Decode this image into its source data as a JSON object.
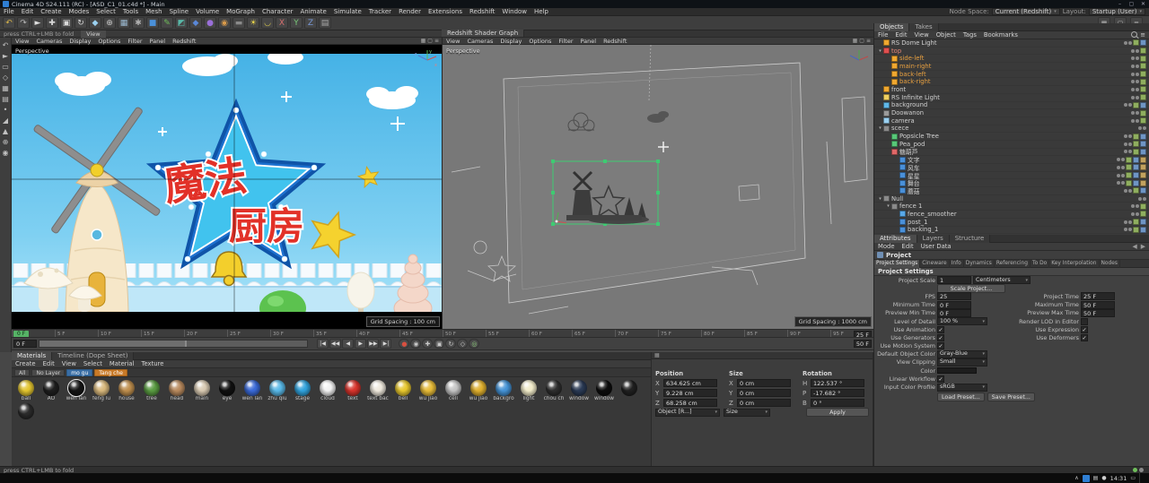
{
  "titlebar": {
    "title": "Cinema 4D S24.111 (RC) - [ASD_C1_01.c4d *] - Main",
    "minimize": "–",
    "maximize": "▢",
    "close": "✕"
  },
  "menubar": {
    "items": [
      "File",
      "Edit",
      "Create",
      "Modes",
      "Select",
      "Tools",
      "Mesh",
      "Spline",
      "Volume",
      "MoGraph",
      "Character",
      "Animate",
      "Simulate",
      "Tracker",
      "Render",
      "Extensions",
      "Redshift",
      "Window",
      "Help"
    ],
    "node_space_label": "Node Space:",
    "node_space_value": "Current (Redshift)",
    "layout_label": "Layout:",
    "layout_value": "Startup (User)"
  },
  "toolbar": {
    "icons": [
      {
        "name": "undo-icon",
        "glyph": "↶",
        "color": "#d8b44a"
      },
      {
        "name": "redo-icon",
        "glyph": "↷",
        "color": "#b8b8b8"
      },
      {
        "name": "live-selection-icon",
        "glyph": "►",
        "color": "#e0e0e0"
      },
      {
        "name": "move-icon",
        "glyph": "✚",
        "color": "#d8d8d8"
      },
      {
        "name": "scale-icon",
        "glyph": "▣",
        "color": "#d8d8d8"
      },
      {
        "name": "rotate-icon",
        "glyph": "↻",
        "color": "#d8d8d8"
      },
      {
        "name": "last-tool-icon",
        "glyph": "◆",
        "color": "#9ad0f0"
      },
      {
        "name": "coordinate-system-icon",
        "glyph": "⊕",
        "color": "#c8c8c8"
      },
      {
        "name": "render-view-icon",
        "glyph": "▦",
        "color": "#9ab8d0"
      },
      {
        "name": "render-settings-icon",
        "glyph": "✱",
        "color": "#b0b0b0"
      },
      {
        "name": "primitive-cube-icon",
        "glyph": "■",
        "color": "#4a90d9"
      },
      {
        "name": "spline-pen-icon",
        "glyph": "✎",
        "color": "#6fbf5a"
      },
      {
        "name": "subdivision-surface-icon",
        "glyph": "◩",
        "color": "#58b8a8"
      },
      {
        "name": "mograph-icon",
        "glyph": "◆",
        "color": "#5a88d8"
      },
      {
        "name": "volume-icon",
        "glyph": "●",
        "color": "#9a6fd9"
      },
      {
        "name": "simulate-icon",
        "glyph": "◉",
        "color": "#d89a4a"
      },
      {
        "name": "camera-tool-icon",
        "glyph": "▬",
        "color": "#8a8a8a"
      },
      {
        "name": "light-tool-icon",
        "glyph": "☀",
        "color": "#e8d44a"
      },
      {
        "name": "snap-icon",
        "glyph": "◡",
        "color": "#d8c84a"
      },
      {
        "name": "axis-x-lock-icon",
        "glyph": "X",
        "color": "#d87070"
      },
      {
        "name": "axis-y-lock-icon",
        "glyph": "Y",
        "color": "#78c878"
      },
      {
        "name": "axis-z-lock-icon",
        "glyph": "Z",
        "color": "#7898d8"
      },
      {
        "name": "workplane-icon",
        "glyph": "▤",
        "color": "#a8a8a8"
      }
    ]
  },
  "fold_strip": {
    "hint": "press CTRL+LMB to fold",
    "tab": "View"
  },
  "tool_column": {
    "icons": [
      {
        "name": "undo-icon",
        "glyph": "↶"
      },
      {
        "name": "selection-icon",
        "glyph": "►"
      },
      {
        "name": "rect-select-icon",
        "glyph": "▭"
      },
      {
        "name": "model-mode-icon",
        "glyph": "◇"
      },
      {
        "name": "texture-mode-icon",
        "glyph": "▦"
      },
      {
        "name": "workplane-mode-icon",
        "glyph": "▤"
      },
      {
        "name": "points-mode-icon",
        "glyph": "•"
      },
      {
        "name": "edges-mode-icon",
        "glyph": "◢"
      },
      {
        "name": "polygons-mode-icon",
        "glyph": "▲"
      },
      {
        "name": "enable-axis-icon",
        "glyph": "⊕"
      },
      {
        "name": "snap-mode-icon",
        "glyph": "◉"
      }
    ]
  },
  "left_viewport": {
    "menu": [
      "View",
      "Cameras",
      "Display",
      "Options",
      "Filter",
      "Panel",
      "Redshift"
    ],
    "label": "Perspective",
    "grid_spacing": "Grid Spacing : 100 cm",
    "title_part1": "魔法",
    "title_part2": "厨房"
  },
  "right_viewport": {
    "tab": "Redshift Shader Graph",
    "menu": [
      "View",
      "Cameras",
      "Display",
      "Options",
      "Filter",
      "Panel",
      "Redshift"
    ],
    "label": "Perspective",
    "grid_spacing": "Grid Spacing : 1000 cm"
  },
  "timeline": {
    "tick_start": 0,
    "tick_end": 95,
    "tick_step": 5,
    "tick_suffix": " F",
    "playhead": "0 F",
    "current_frame": "0 F",
    "preview_end": "25 F",
    "range_end": "50 F",
    "transport": [
      {
        "name": "goto-start-button",
        "glyph": "|◀"
      },
      {
        "name": "prev-key-button",
        "glyph": "◀◀"
      },
      {
        "name": "prev-frame-button",
        "glyph": "◀"
      },
      {
        "name": "play-button",
        "glyph": "▶"
      },
      {
        "name": "next-frame-button",
        "glyph": "▶▶"
      },
      {
        "name": "goto-end-button",
        "glyph": "▶|"
      }
    ],
    "record": [
      {
        "name": "record-button",
        "glyph": "●",
        "color": "#d85040"
      },
      {
        "name": "autokey-button",
        "glyph": "◉",
        "color": "#c8c8c8"
      },
      {
        "name": "keyframe-position-button",
        "glyph": "✚",
        "color": "#c8c8c8"
      },
      {
        "name": "keyframe-scale-button",
        "glyph": "▣",
        "color": "#c8c8c8"
      },
      {
        "name": "keyframe-rotation-button",
        "glyph": "↻",
        "color": "#c8c8c8"
      },
      {
        "name": "keyframe-params-button",
        "glyph": "◇",
        "color": "#c8c8c8"
      },
      {
        "name": "solo-button",
        "glyph": "◎",
        "color": "#8ac879"
      }
    ]
  },
  "objects_panel": {
    "tabs": [
      "Objects",
      "Takes"
    ],
    "active_tab": "Objects",
    "menu": [
      "File",
      "Edit",
      "View",
      "Object",
      "Tags",
      "Bookmarks"
    ],
    "items": [
      {
        "name": "RS Dome Light",
        "depth": 0,
        "icon": "#f0a830",
        "tags": 2
      },
      {
        "name": "top",
        "depth": 0,
        "arrow": true,
        "icon": "#e05050",
        "color": "#e88878",
        "tags": 1
      },
      {
        "name": "side-left",
        "depth": 1,
        "icon": "#f0a830",
        "color": "#e8a040",
        "tags": 1
      },
      {
        "name": "main-right",
        "depth": 1,
        "icon": "#f0a830",
        "color": "#e8a040",
        "tags": 1
      },
      {
        "name": "back-left",
        "depth": 1,
        "icon": "#f0a830",
        "color": "#e8a040",
        "tags": 1
      },
      {
        "name": "back-right",
        "depth": 1,
        "icon": "#f0a830",
        "color": "#e8a040",
        "tags": 1
      },
      {
        "name": "front",
        "depth": 0,
        "icon": "#f0a830",
        "tags": 1
      },
      {
        "name": "RS Infinite Light",
        "depth": 0,
        "icon": "#f0d060",
        "tags": 1
      },
      {
        "name": "background",
        "depth": 0,
        "icon": "#60b8e8",
        "tags": 2
      },
      {
        "name": "Doowanon",
        "depth": 0,
        "icon": "#9a9a9a",
        "tags": 1
      },
      {
        "name": "camera",
        "depth": 0,
        "icon": "#9ad0f0",
        "tags": 1
      },
      {
        "name": "scece",
        "depth": 0,
        "arrow": true,
        "icon": "#8a8a8a",
        "tags": 0
      },
      {
        "name": "Popsicle Tree",
        "depth": 1,
        "icon": "#58c878",
        "tags": 2
      },
      {
        "name": "Pea_pod",
        "depth": 1,
        "icon": "#58c878",
        "tags": 2
      },
      {
        "name": "糖葫芦",
        "depth": 1,
        "icon": "#e06868",
        "tags": 2
      },
      {
        "name": "文字",
        "depth": 2,
        "icon": "#4a90d9",
        "tags": 3
      },
      {
        "name": "风车",
        "depth": 2,
        "icon": "#4a90d9",
        "tags": 3
      },
      {
        "name": "星星",
        "depth": 2,
        "icon": "#4a90d9",
        "tags": 3
      },
      {
        "name": "舞台",
        "depth": 2,
        "icon": "#4a90d9",
        "tags": 3
      },
      {
        "name": "蘑菇",
        "depth": 2,
        "icon": "#4a90d9",
        "tags": 2
      },
      {
        "name": "Null",
        "depth": 0,
        "arrow": true,
        "icon": "#8a8a8a",
        "tags": 0
      },
      {
        "name": "fence 1",
        "depth": 1,
        "arrow": true,
        "icon": "#8a8a8a",
        "tags": 1
      },
      {
        "name": "fence_smoother",
        "depth": 2,
        "icon": "#58a8e8",
        "tags": 1
      },
      {
        "name": "post_1",
        "depth": 2,
        "icon": "#4a90d9",
        "tags": 2
      },
      {
        "name": "backing_1",
        "depth": 2,
        "icon": "#4a90d9",
        "tags": 2
      }
    ]
  },
  "attributes_panel": {
    "tabs": [
      "Attributes",
      "Layers",
      "Structure"
    ],
    "active_tab": "Attributes",
    "menu": [
      "Mode",
      "Edit",
      "User Data"
    ],
    "nav_back": "◀",
    "nav_fwd": "▶",
    "object_title": "Project",
    "section_tabs": [
      "Project Settings",
      "Cineware",
      "Info",
      "Dynamics",
      "Referencing",
      "To Do",
      "Key Interpolation",
      "Nodes"
    ],
    "active_section_tab": "Project Settings",
    "section_header": "Project Settings",
    "project_scale_label": "Project Scale",
    "project_scale_value": "1",
    "project_scale_unit": "Centimeters",
    "scale_project_button": "Scale Project...",
    "rows": [
      {
        "l": "FPS",
        "lt": "input",
        "lv": "25",
        "r": "Project Time",
        "rt": "input",
        "rv": "25 F"
      },
      {
        "l": "Minimum Time",
        "lt": "input",
        "lv": "0 F",
        "r": "Maximum Time",
        "rt": "input",
        "rv": "50 F"
      },
      {
        "l": "Preview Min Time",
        "lt": "input",
        "lv": "0 F",
        "r": "Preview Max Time",
        "rt": "input",
        "rv": "50 F"
      },
      {
        "l": "Level of Detail",
        "lt": "drop",
        "lv": "100 %",
        "r": "Render LOD in Editor",
        "rt": "check",
        "rv": false
      },
      {
        "l": "Use Animation",
        "lt": "check",
        "lv": true,
        "r": "Use Expression",
        "rt": "check",
        "rv": true
      },
      {
        "l": "Use Generators",
        "lt": "check",
        "lv": true,
        "r": "Use Deformers",
        "rt": "check",
        "rv": true
      },
      {
        "l": "Use Motion System",
        "lt": "check",
        "lv": true
      },
      {
        "l": "Default Object Color",
        "lt": "drop",
        "lv": "Gray-Blue"
      },
      {
        "l": "View Clipping",
        "lt": "drop",
        "lv": "Small"
      },
      {
        "l": "Color",
        "lt": "swatch"
      },
      {
        "l": "Linear Workflow",
        "lt": "check",
        "lv": true
      },
      {
        "l": "Input Color Profile",
        "lt": "drop",
        "lv": "sRGB"
      }
    ],
    "preset_buttons": [
      "Load Preset...",
      "Save Preset..."
    ]
  },
  "materials_panel": {
    "tabs": [
      "Materials",
      "Timeline (Dope Sheet)"
    ],
    "active_tab": "Materials",
    "menu": [
      "Create",
      "Edit",
      "View",
      "Select",
      "Material",
      "Texture"
    ],
    "layer_buttons": [
      {
        "label": "All",
        "style": "plain"
      },
      {
        "label": "No Layer",
        "style": "plain"
      },
      {
        "label": "mo gu",
        "style": "blue"
      },
      {
        "label": "Tang che",
        "style": "orange"
      }
    ],
    "materials": [
      {
        "name": "ball",
        "color": "#e3c52f"
      },
      {
        "name": "AO",
        "color": "#1e1e1e"
      },
      {
        "name": "wen lan",
        "color": "#141414"
      },
      {
        "name": "feng lu",
        "color": "#d8b87c"
      },
      {
        "name": "house",
        "color": "#bf8f4e"
      },
      {
        "name": "tree",
        "color": "#5a9c42"
      },
      {
        "name": "head",
        "color": "#b98a5e"
      },
      {
        "name": "main",
        "color": "#d9cab2"
      },
      {
        "name": "eye",
        "color": "#101010"
      },
      {
        "name": "wen lan",
        "color": "#3a6ad8"
      },
      {
        "name": "zhu qiu",
        "color": "#59b9e8"
      },
      {
        "name": "stage",
        "color": "#31a3dd"
      },
      {
        "name": "cloud",
        "color": "#f2f2f2"
      },
      {
        "name": "text",
        "color": "#d8342c"
      },
      {
        "name": "text bac",
        "color": "#efe9dd"
      },
      {
        "name": "bell",
        "color": "#e8c82e"
      },
      {
        "name": "wu jiao",
        "color": "#e8bc38"
      },
      {
        "name": "cell",
        "color": "#c4c4c4"
      },
      {
        "name": "wu jiao",
        "color": "#e0b02e"
      },
      {
        "name": "backgro",
        "color": "#4593d6"
      },
      {
        "name": "light",
        "color": "#f2ecca"
      },
      {
        "name": "chou ch",
        "color": "#2e2e2e"
      },
      {
        "name": "window",
        "color": "#2a3a55"
      },
      {
        "name": "window",
        "color": "#0c0c0c"
      },
      {
        "name": "",
        "color": "#202020"
      },
      {
        "name": "",
        "color": "#2a2a2a"
      }
    ],
    "selected_index": 2
  },
  "coordinates_panel": {
    "groups": [
      {
        "title": "Position",
        "axes": [
          {
            "k": "X",
            "v": "634.625 cm"
          },
          {
            "k": "Y",
            "v": "9.228 cm"
          },
          {
            "k": "Z",
            "v": "68.258 cm"
          }
        ]
      },
      {
        "title": "Size",
        "axes": [
          {
            "k": "X",
            "v": "0 cm"
          },
          {
            "k": "Y",
            "v": "0 cm"
          },
          {
            "k": "Z",
            "v": "0 cm"
          }
        ]
      },
      {
        "title": "Rotation",
        "axes": [
          {
            "k": "H",
            "v": "122.537 °"
          },
          {
            "k": "P",
            "v": "-17.682 °"
          },
          {
            "k": "B",
            "v": "0 °"
          }
        ]
      }
    ],
    "mode_dropdown": "Object [R...]",
    "size_dropdown": "Size",
    "apply_button": "Apply"
  },
  "statusbar": {
    "text": "press CTRL+LMB to fold"
  },
  "taskbar": {
    "time": "14:31",
    "caret": "∧"
  }
}
